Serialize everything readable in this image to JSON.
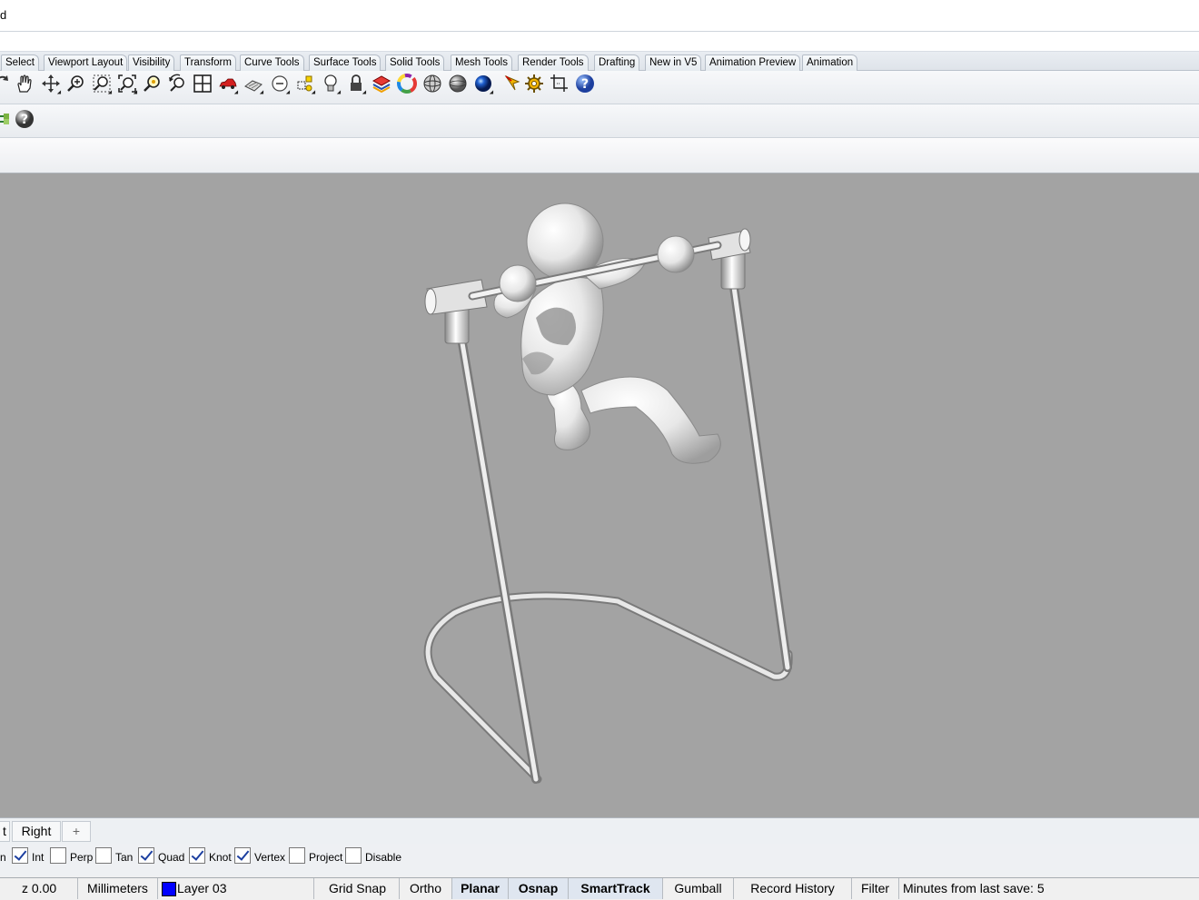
{
  "command": {
    "text": "d"
  },
  "toolbar_tabs": [
    "Select",
    "Viewport Layout",
    "Visibility",
    "Transform",
    "Curve Tools",
    "Surface Tools",
    "Solid Tools",
    "Mesh Tools",
    "Render Tools",
    "Drafting",
    "New in V5",
    "Animation Preview",
    "Animation"
  ],
  "toolbar_icons": [
    "rotate-view-icon",
    "pan-hand-icon",
    "move-cross-icon",
    "zoom-dynamic-icon",
    "zoom-window-icon",
    "zoom-extents-icon",
    "zoom-selected-icon",
    "undo-view-icon",
    "four-viewports-icon",
    "car-icon",
    "cplane-icon",
    "point-circle-icon",
    "select-objects-icon",
    "lightbulb-icon",
    "lock-icon",
    "layer-color-icon",
    "color-wheel-icon",
    "wireframe-sphere-icon",
    "shaded-sphere-icon",
    "rendered-sphere-icon",
    "cursor-star-icon",
    "gear-icon",
    "crop-icon",
    "help-icon"
  ],
  "toolbar2_icons": [
    "tree-icon",
    "help-icon"
  ],
  "view_tabs": {
    "first": "t",
    "right": "Right",
    "add": "+"
  },
  "osnaps": [
    {
      "label": "n",
      "checked": null
    },
    {
      "label": "Int",
      "checked": true
    },
    {
      "label": "Perp",
      "checked": false
    },
    {
      "label": "Tan",
      "checked": false
    },
    {
      "label": "Quad",
      "checked": true
    },
    {
      "label": "Knot",
      "checked": true
    },
    {
      "label": "Vertex",
      "checked": true
    },
    {
      "label": "Project",
      "checked": false
    },
    {
      "label": "Disable",
      "checked": false
    }
  ],
  "status": {
    "z": "z 0.00",
    "units": "Millimeters",
    "layer": "Layer 03",
    "layer_color": "#0000ff",
    "grid_snap": "Grid Snap",
    "ortho": "Ortho",
    "planar": "Planar",
    "osnap": "Osnap",
    "smarttrack": "SmartTrack",
    "gumball": "Gumball",
    "record_history": "Record History",
    "filter": "Filter",
    "save": "Minutes from last save: 5"
  },
  "colors": {
    "viewport_bg": "#a3a3a3",
    "model": "#e6e6e6"
  }
}
